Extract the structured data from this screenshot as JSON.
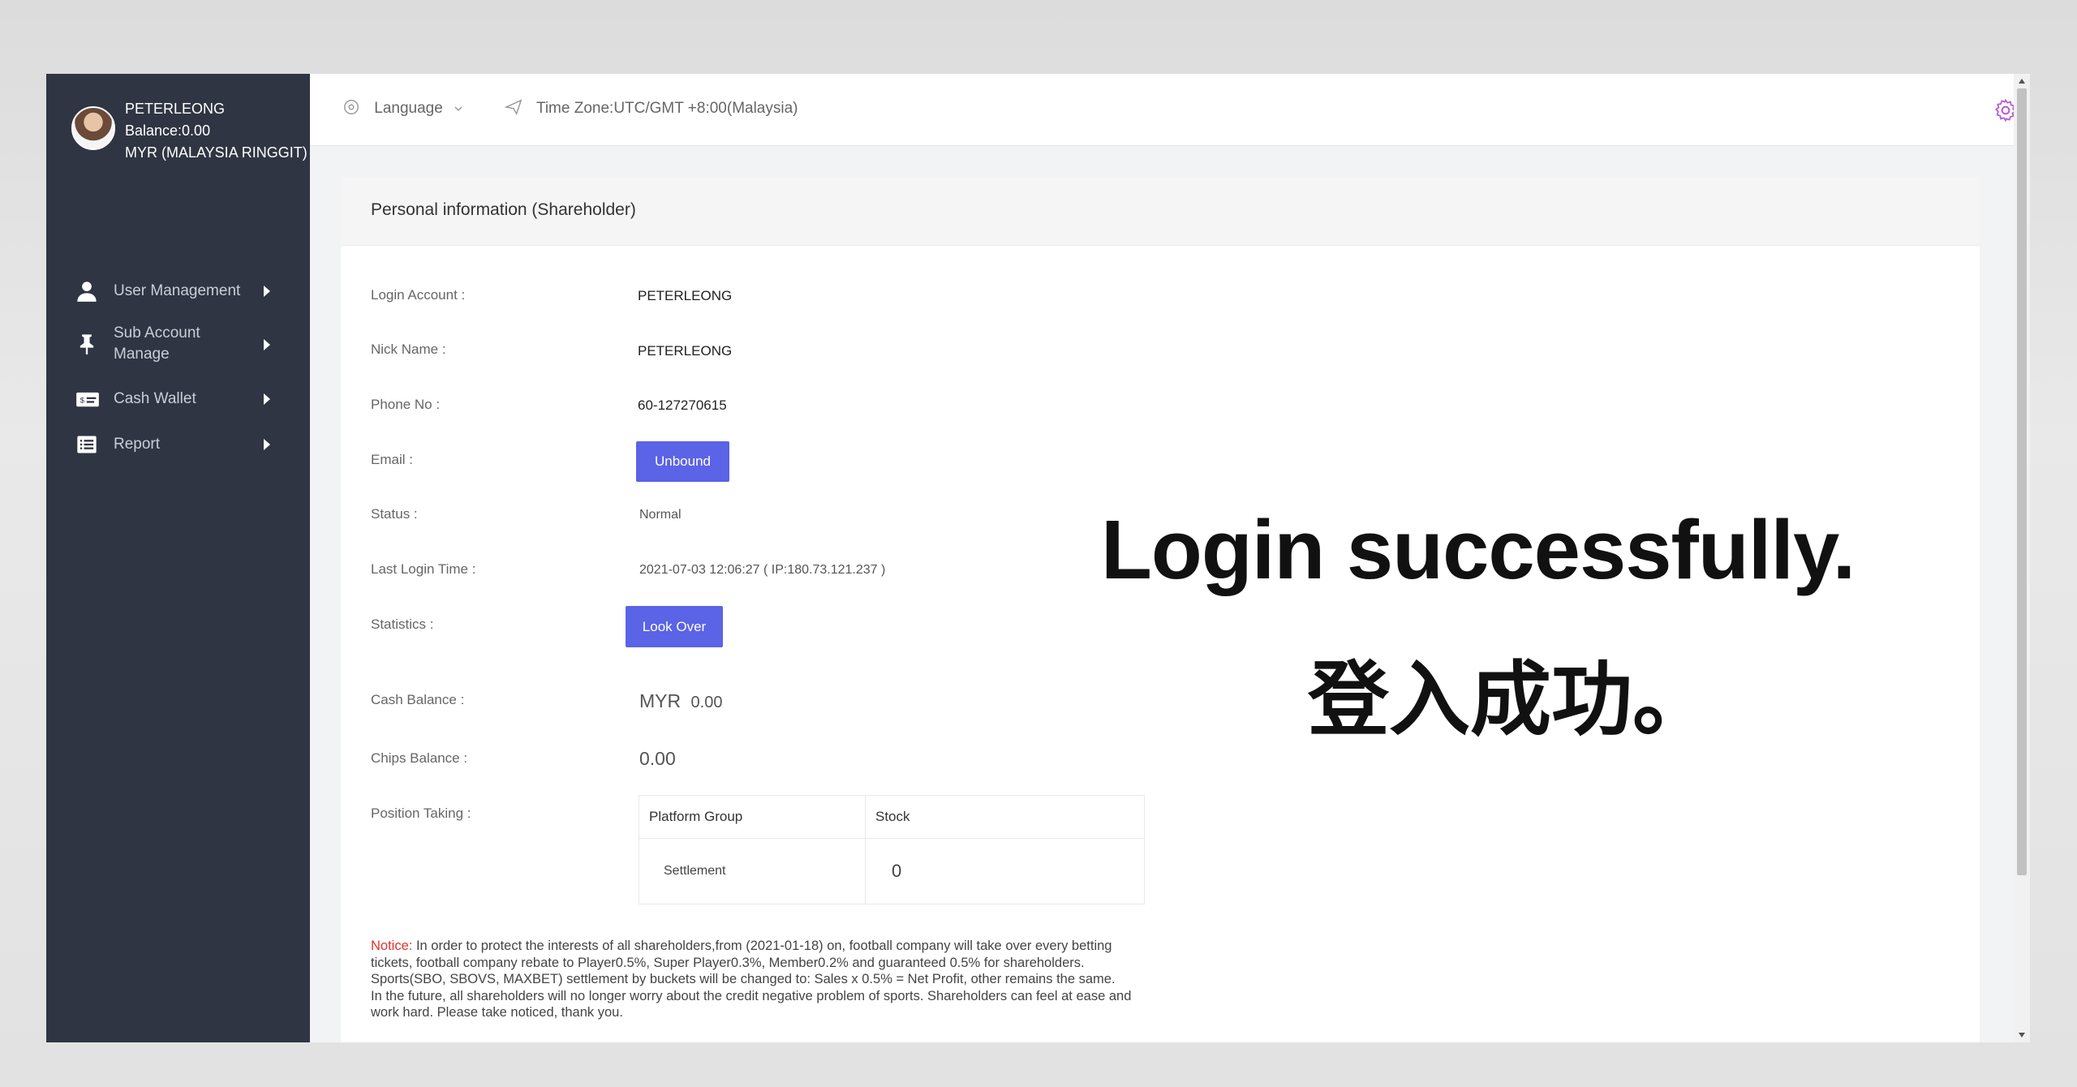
{
  "sidebar": {
    "username": "PETERLEONG",
    "balance": "Balance:0.00",
    "currency": "MYR (MALAYSIA RINGGIT)",
    "items": [
      {
        "label": "User Management",
        "icon": "user-icon"
      },
      {
        "label": "Sub Account Manage",
        "icon": "pin-icon"
      },
      {
        "label": "Cash Wallet",
        "icon": "cash-icon"
      },
      {
        "label": "Report",
        "icon": "list-icon"
      }
    ]
  },
  "topbar": {
    "language": "Language",
    "timezone": "Time Zone:UTC/GMT +8:00(Malaysia)",
    "settings_icon": "gear-icon"
  },
  "panel": {
    "title": "Personal information (Shareholder)",
    "fields": {
      "login_account_label": "Login Account :",
      "login_account": "PETERLEONG",
      "nick_name_label": "Nick Name :",
      "nick_name": "PETERLEONG",
      "phone_label": "Phone No :",
      "phone": "60-127270615",
      "email_label": "Email :",
      "email_button": "Unbound",
      "status_label": "Status :",
      "status": "Normal",
      "last_login_label": "Last Login Time :",
      "last_login": "2021-07-03 12:06:27 ( IP:180.73.121.237 )",
      "statistics_label": "Statistics :",
      "statistics_button": "Look Over",
      "cash_balance_label": "Cash Balance :",
      "cash_currency": "MYR",
      "cash_balance": "0.00",
      "chips_balance_label": "Chips Balance :",
      "chips_balance": "0.00",
      "position_taking_label": "Position Taking :"
    },
    "position_table": {
      "headers": [
        "Platform Group",
        "Stock"
      ],
      "rows": [
        [
          "Settlement",
          "0"
        ]
      ]
    },
    "notice_label": "Notice:",
    "notice_text": " In order to protect the interests of all shareholders,from (2021-01-18) on, football company will take over every betting tickets, football company rebate to Player0.5%, Super Player0.3%, Member0.2% and guaranteed 0.5% for shareholders. Sports(SBO, SBOVS, MAXBET) settlement by buckets will be changed to: Sales x 0.5% = Net Profit, other remains the same.",
    "notice_text_2": "In the future, all shareholders will no longer worry about the credit negative problem of sports. Shareholders can feel at ease and work hard. Please take noticed, thank you."
  },
  "overlay": {
    "english": "Login successfully.",
    "chinese": "登入成功。"
  },
  "colors": {
    "sidebar_bg": "#2f3542",
    "accent_button": "#5b63e6",
    "notice_red": "#e0332b",
    "gear_purple": "#b65bd6"
  }
}
